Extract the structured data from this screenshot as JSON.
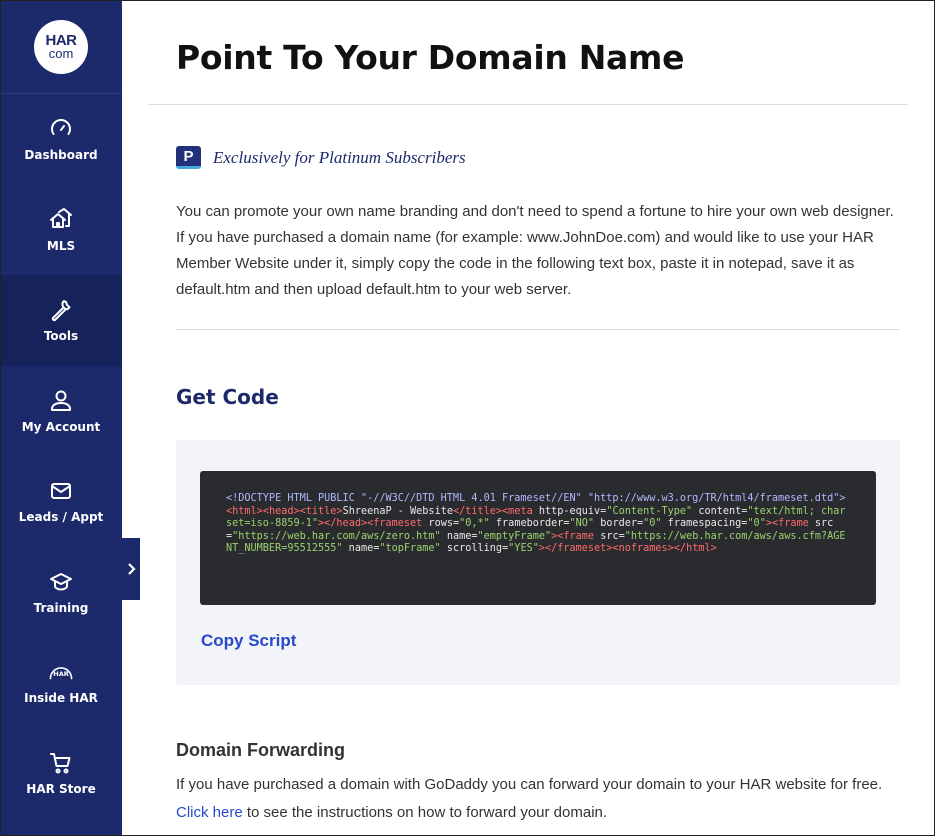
{
  "logo": {
    "line1": "HAR",
    "line2": "com"
  },
  "sidebar": {
    "items": [
      {
        "label": "Dashboard",
        "icon": "dashboard-gauge-icon"
      },
      {
        "label": "MLS",
        "icon": "houses-icon"
      },
      {
        "label": "Tools",
        "icon": "wrench-icon",
        "active": true
      },
      {
        "label": "My Account",
        "icon": "user-icon"
      },
      {
        "label": "Leads / Appt",
        "icon": "envelope-icon"
      },
      {
        "label": "Training",
        "icon": "graduation-cap-icon"
      },
      {
        "label": "Inside HAR",
        "icon": "har-badge-icon"
      },
      {
        "label": "HAR Store",
        "icon": "shopping-cart-icon"
      }
    ],
    "collapse_icon": "chevron-right-icon"
  },
  "main": {
    "title": "Point To Your Domain Name",
    "badge_letter": "P",
    "badge_text": "Exclusively for Platinum Subscribers",
    "intro": "You can promote your own name branding and don't need to spend a fortune to hire your own web designer. If you have purchased a domain name (for example: www.JohnDoe.com) and would like to use your HAR Member Website under it, simply copy the code in the following text box, paste it in notepad, save it as default.htm and then upload default.htm to your web server.",
    "get_code_title": "Get Code",
    "code": {
      "doctype": "<!DOCTYPE HTML PUBLIC \"-//W3C//DTD HTML 4.01 Frameset//EN\" \"http://www.w3.org/TR/html4/frameset.dtd\">",
      "html_open": "<html>",
      "head_open": "<head>",
      "title_open": "<title>",
      "title_text": "ShreenaP - Website",
      "title_close": "</title>",
      "meta_open": "<meta",
      "meta_attr1": " http-equiv=",
      "meta_val1": "\"Content-Type\"",
      "meta_attr2": " content=",
      "meta_val2": "\"text/html; charset=iso-8859-1\"",
      "meta_close": ">",
      "head_close": "</head>",
      "frameset_open": "<frameset",
      "fs_attr1": " rows=",
      "fs_val1": "\"0,*\"",
      "fs_attr2": " frameborder=",
      "fs_val2": "\"NO\"",
      "fs_attr3": " border=",
      "fs_val3": "\"0\"",
      "fs_attr4": " framespacing=",
      "fs_val4": "\"0\"",
      "fs_close": ">",
      "frame1_open": "<frame",
      "f1_attr1": " src=",
      "f1_val1": "\"https://web.har.com/aws/zero.htm\"",
      "f1_attr2": " name=",
      "f1_val2": "\"emptyFrame\"",
      "f1_close": ">",
      "frame2_open": "<frame",
      "f2_attr1": " src=",
      "f2_val1": "\"https://web.har.com/aws/aws.cfm?AGENT_NUMBER=95512555\"",
      "f2_attr2": " name=",
      "f2_val2": "\"topFrame\"",
      "f2_attr3": " scrolling=",
      "f2_val3": "\"YES\"",
      "f2_close": ">",
      "frameset_close": "</frameset>",
      "noframes": "<noframes>",
      "html_close": "</html>"
    },
    "copy_label": "Copy Script",
    "forwarding_title": "Domain Forwarding",
    "forwarding_text_before": "If you have purchased a domain with GoDaddy you can forward your domain to your HAR website for free. ",
    "forwarding_link": "Click here",
    "forwarding_text_after": " to see the instructions on how to forward your domain."
  }
}
